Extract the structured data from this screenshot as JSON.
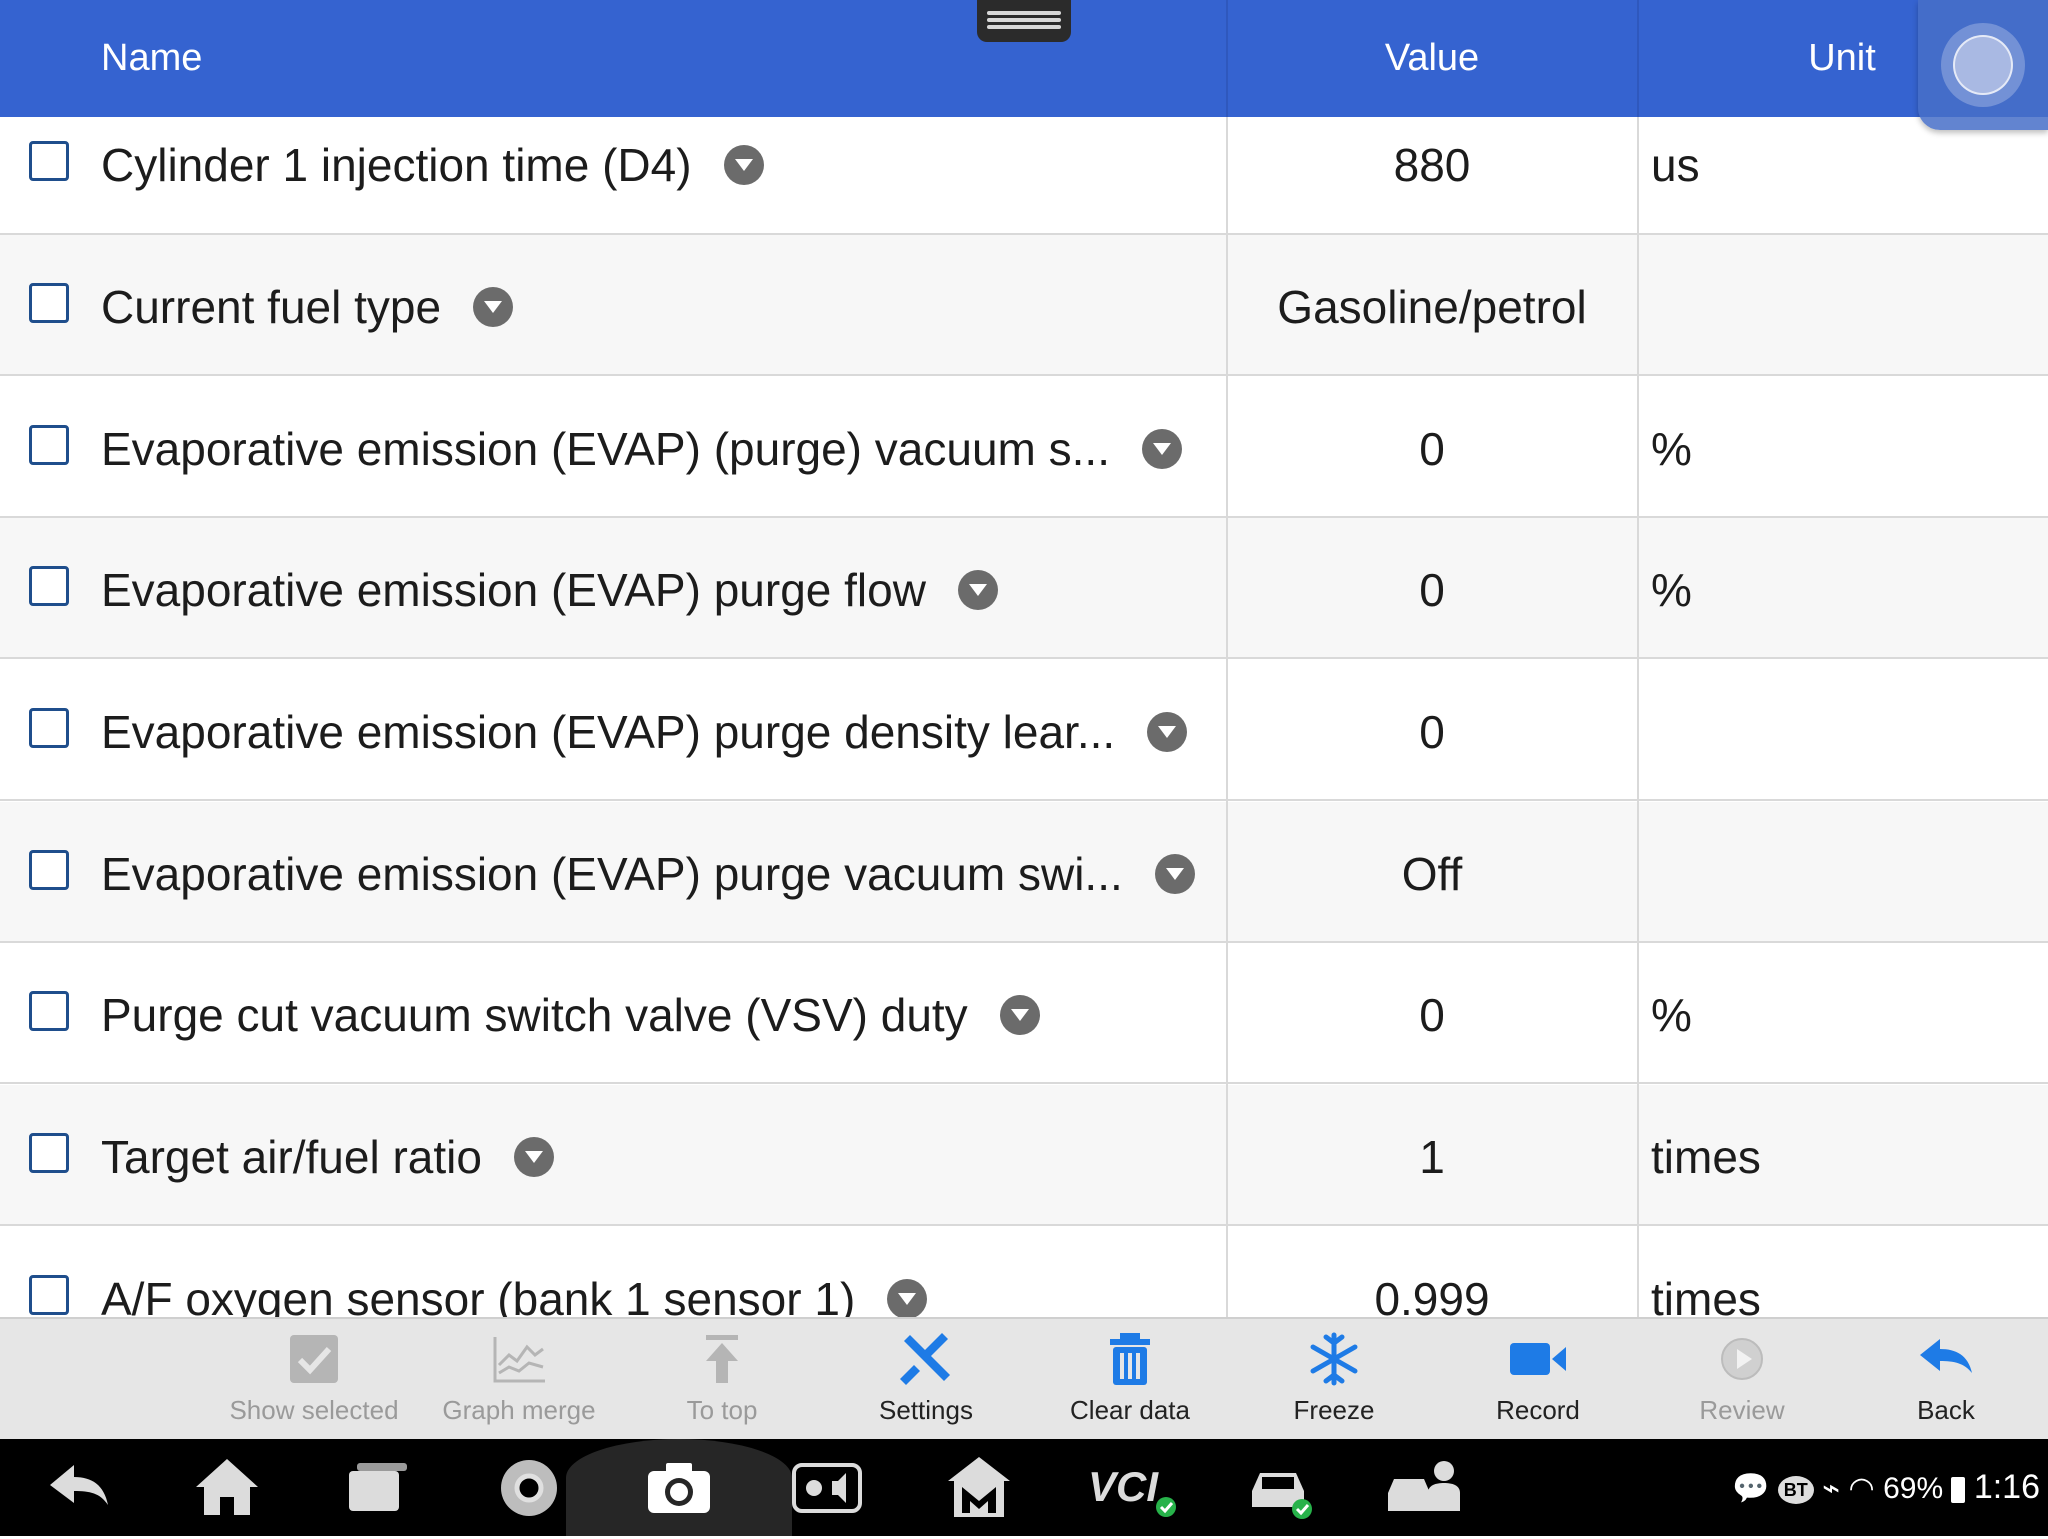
{
  "header": {
    "name": "Name",
    "value": "Value",
    "unit": "Unit"
  },
  "rows": [
    {
      "name": "Cylinder 1 injection time (D4)",
      "value": "880",
      "unit": "us"
    },
    {
      "name": "Current fuel type",
      "value": "Gasoline/petrol",
      "unit": ""
    },
    {
      "name": "Evaporative emission (EVAP) (purge) vacuum s...",
      "value": "0",
      "unit": "%"
    },
    {
      "name": "Evaporative emission (EVAP) purge flow",
      "value": "0",
      "unit": "%"
    },
    {
      "name": "Evaporative emission (EVAP) purge density lear...",
      "value": "0",
      "unit": ""
    },
    {
      "name": "Evaporative emission (EVAP) purge vacuum swi...",
      "value": "Off",
      "unit": ""
    },
    {
      "name": "Purge cut vacuum switch valve (VSV) duty",
      "value": "0",
      "unit": "%"
    },
    {
      "name": "Target air/fuel ratio",
      "value": "1",
      "unit": "times"
    },
    {
      "name": "A/F oxygen sensor (bank 1 sensor 1)",
      "value": "0.999",
      "unit": "times"
    }
  ],
  "toolbar": {
    "show_selected": "Show selected",
    "graph_merge": "Graph merge",
    "to_top": "To top",
    "settings": "Settings",
    "clear_data": "Clear data",
    "freeze": "Freeze",
    "record": "Record",
    "review": "Review",
    "back": "Back"
  },
  "status": {
    "battery": "69%",
    "time": "1:16",
    "bt": "BT"
  },
  "colors": {
    "header": "#3563d0",
    "accent": "#1e7be6",
    "toolbar": "#e6e6e6"
  }
}
